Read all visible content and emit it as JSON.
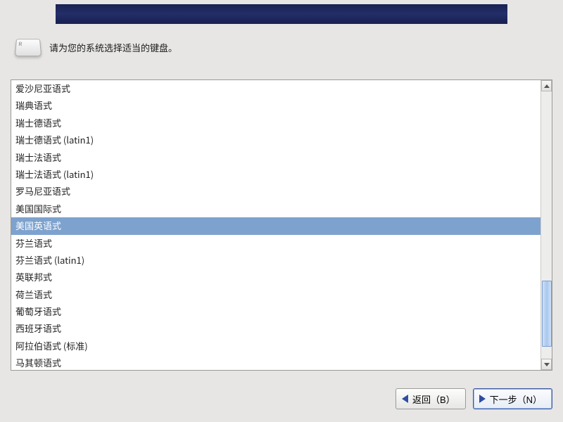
{
  "prompt": "请为您的系统选择适当的键盘。",
  "selected_index": 8,
  "keyboard_options": [
    "爱沙尼亚语式",
    "瑞典语式",
    "瑞士德语式",
    "瑞士德语式 (latin1)",
    "瑞士法语式",
    "瑞士法语式 (latin1)",
    "罗马尼亚语式",
    "美国国际式",
    "美国英语式",
    "芬兰语式",
    "芬兰语式 (latin1)",
    "英联邦式",
    "荷兰语式",
    "葡萄牙语式",
    "西班牙语式",
    "阿拉伯语式 (标准)",
    "马其顿语式"
  ],
  "buttons": {
    "back": "返回（B）",
    "next": "下一步（N）"
  }
}
